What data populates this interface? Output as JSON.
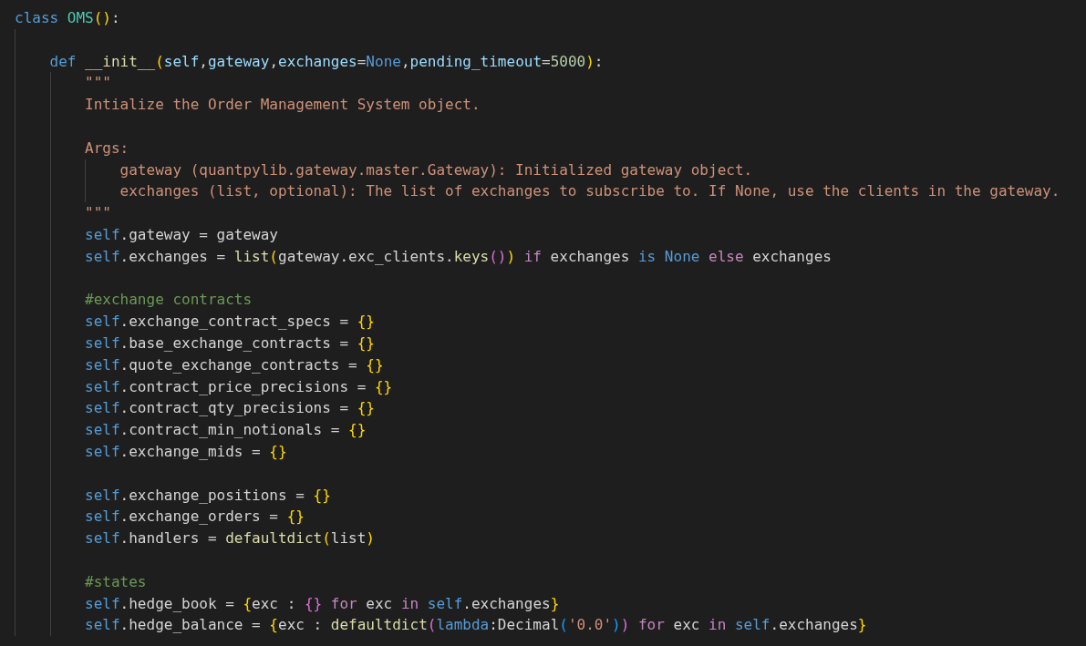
{
  "editor": {
    "lines": [
      {
        "kind": "code",
        "tokens": [
          {
            "kind": "keyword",
            "text": "class "
          },
          {
            "kind": "class",
            "text": "OMS"
          },
          {
            "kind": "bracket1",
            "text": "()"
          },
          {
            "kind": "plain",
            "text": ":"
          }
        ],
        "children": [
          {
            "kind": "blank"
          },
          {
            "kind": "code",
            "tokens": [
              {
                "kind": "keyword",
                "text": "def "
              },
              {
                "kind": "function",
                "text": "__init__"
              },
              {
                "kind": "bracket1",
                "text": "("
              },
              {
                "kind": "param",
                "text": "self"
              },
              {
                "kind": "plain",
                "text": ","
              },
              {
                "kind": "param",
                "text": "gateway"
              },
              {
                "kind": "plain",
                "text": ","
              },
              {
                "kind": "param",
                "text": "exchanges"
              },
              {
                "kind": "plain",
                "text": "="
              },
              {
                "kind": "keyword",
                "text": "None"
              },
              {
                "kind": "plain",
                "text": ","
              },
              {
                "kind": "param",
                "text": "pending_timeout"
              },
              {
                "kind": "plain",
                "text": "="
              },
              {
                "kind": "number",
                "text": "5000"
              },
              {
                "kind": "bracket1",
                "text": ")"
              },
              {
                "kind": "plain",
                "text": ":"
              }
            ],
            "children": [
              {
                "kind": "code",
                "tokens": [
                  {
                    "kind": "string",
                    "text": "\"\"\""
                  }
                ]
              },
              {
                "kind": "code",
                "tokens": [
                  {
                    "kind": "string",
                    "text": "Intialize the Order Management System object."
                  }
                ]
              },
              {
                "kind": "blank"
              },
              {
                "kind": "code",
                "tokens": [
                  {
                    "kind": "string",
                    "text": "Args:"
                  }
                ],
                "children": [
                  {
                    "kind": "code",
                    "tokens": [
                      {
                        "kind": "string",
                        "text": "gateway (quantpylib.gateway.master.Gateway): Initialized gateway object."
                      }
                    ]
                  },
                  {
                    "kind": "code",
                    "tokens": [
                      {
                        "kind": "string",
                        "text": "exchanges (list, optional): The list of exchanges to subscribe to. If None, use the clients in the gateway."
                      }
                    ]
                  }
                ]
              },
              {
                "kind": "code",
                "tokens": [
                  {
                    "kind": "string",
                    "text": "\"\"\""
                  }
                ]
              },
              {
                "kind": "code",
                "tokens": [
                  {
                    "kind": "self",
                    "text": "self"
                  },
                  {
                    "kind": "plain",
                    "text": ".gateway = gateway"
                  }
                ]
              },
              {
                "kind": "code",
                "tokens": [
                  {
                    "kind": "self",
                    "text": "self"
                  },
                  {
                    "kind": "plain",
                    "text": ".exchanges = "
                  },
                  {
                    "kind": "function",
                    "text": "list"
                  },
                  {
                    "kind": "bracket1",
                    "text": "("
                  },
                  {
                    "kind": "plain",
                    "text": "gateway.exc_clients."
                  },
                  {
                    "kind": "function",
                    "text": "keys"
                  },
                  {
                    "kind": "bracket2",
                    "text": "()"
                  },
                  {
                    "kind": "bracket1",
                    "text": ") "
                  },
                  {
                    "kind": "control",
                    "text": "if"
                  },
                  {
                    "kind": "plain",
                    "text": " exchanges "
                  },
                  {
                    "kind": "keyword",
                    "text": "is "
                  },
                  {
                    "kind": "keyword",
                    "text": "None "
                  },
                  {
                    "kind": "control",
                    "text": "else"
                  },
                  {
                    "kind": "plain",
                    "text": " exchanges"
                  }
                ]
              },
              {
                "kind": "blank"
              },
              {
                "kind": "code",
                "tokens": [
                  {
                    "kind": "comment",
                    "text": "#exchange contracts"
                  }
                ]
              },
              {
                "kind": "code",
                "tokens": [
                  {
                    "kind": "self",
                    "text": "self"
                  },
                  {
                    "kind": "plain",
                    "text": ".exchange_contract_specs = "
                  },
                  {
                    "kind": "bracket1",
                    "text": "{}"
                  }
                ]
              },
              {
                "kind": "code",
                "tokens": [
                  {
                    "kind": "self",
                    "text": "self"
                  },
                  {
                    "kind": "plain",
                    "text": ".base_exchange_contracts = "
                  },
                  {
                    "kind": "bracket1",
                    "text": "{}"
                  }
                ]
              },
              {
                "kind": "code",
                "tokens": [
                  {
                    "kind": "self",
                    "text": "self"
                  },
                  {
                    "kind": "plain",
                    "text": ".quote_exchange_contracts = "
                  },
                  {
                    "kind": "bracket1",
                    "text": "{}"
                  }
                ]
              },
              {
                "kind": "code",
                "tokens": [
                  {
                    "kind": "self",
                    "text": "self"
                  },
                  {
                    "kind": "plain",
                    "text": ".contract_price_precisions = "
                  },
                  {
                    "kind": "bracket1",
                    "text": "{}"
                  }
                ]
              },
              {
                "kind": "code",
                "tokens": [
                  {
                    "kind": "self",
                    "text": "self"
                  },
                  {
                    "kind": "plain",
                    "text": ".contract_qty_precisions = "
                  },
                  {
                    "kind": "bracket1",
                    "text": "{}"
                  }
                ]
              },
              {
                "kind": "code",
                "tokens": [
                  {
                    "kind": "self",
                    "text": "self"
                  },
                  {
                    "kind": "plain",
                    "text": ".contract_min_notionals = "
                  },
                  {
                    "kind": "bracket1",
                    "text": "{}"
                  }
                ]
              },
              {
                "kind": "code",
                "tokens": [
                  {
                    "kind": "self",
                    "text": "self"
                  },
                  {
                    "kind": "plain",
                    "text": ".exchange_mids = "
                  },
                  {
                    "kind": "bracket1",
                    "text": "{}"
                  }
                ]
              },
              {
                "kind": "blank"
              },
              {
                "kind": "code",
                "tokens": [
                  {
                    "kind": "self",
                    "text": "self"
                  },
                  {
                    "kind": "plain",
                    "text": ".exchange_positions = "
                  },
                  {
                    "kind": "bracket1",
                    "text": "{}"
                  }
                ]
              },
              {
                "kind": "code",
                "tokens": [
                  {
                    "kind": "self",
                    "text": "self"
                  },
                  {
                    "kind": "plain",
                    "text": ".exchange_orders = "
                  },
                  {
                    "kind": "bracket1",
                    "text": "{}"
                  }
                ]
              },
              {
                "kind": "code",
                "tokens": [
                  {
                    "kind": "self",
                    "text": "self"
                  },
                  {
                    "kind": "plain",
                    "text": ".handlers = "
                  },
                  {
                    "kind": "function",
                    "text": "defaultdict"
                  },
                  {
                    "kind": "bracket1",
                    "text": "("
                  },
                  {
                    "kind": "plain",
                    "text": "list"
                  },
                  {
                    "kind": "bracket1",
                    "text": ")"
                  }
                ]
              },
              {
                "kind": "blank"
              },
              {
                "kind": "code",
                "tokens": [
                  {
                    "kind": "comment",
                    "text": "#states"
                  }
                ]
              },
              {
                "kind": "code",
                "tokens": [
                  {
                    "kind": "self",
                    "text": "self"
                  },
                  {
                    "kind": "plain",
                    "text": ".hedge_book = "
                  },
                  {
                    "kind": "bracket1",
                    "text": "{"
                  },
                  {
                    "kind": "plain",
                    "text": "exc : "
                  },
                  {
                    "kind": "bracket2",
                    "text": "{} "
                  },
                  {
                    "kind": "control",
                    "text": "for"
                  },
                  {
                    "kind": "plain",
                    "text": " exc "
                  },
                  {
                    "kind": "control",
                    "text": "in "
                  },
                  {
                    "kind": "self",
                    "text": "self"
                  },
                  {
                    "kind": "plain",
                    "text": ".exchanges"
                  },
                  {
                    "kind": "bracket1",
                    "text": "}"
                  }
                ]
              },
              {
                "kind": "code",
                "tokens": [
                  {
                    "kind": "self",
                    "text": "self"
                  },
                  {
                    "kind": "plain",
                    "text": ".hedge_balance = "
                  },
                  {
                    "kind": "bracket1",
                    "text": "{"
                  },
                  {
                    "kind": "plain",
                    "text": "exc : "
                  },
                  {
                    "kind": "function",
                    "text": "defaultdict"
                  },
                  {
                    "kind": "bracket2",
                    "text": "("
                  },
                  {
                    "kind": "keyword",
                    "text": "lambda"
                  },
                  {
                    "kind": "plain",
                    "text": ":Decimal"
                  },
                  {
                    "kind": "bracket3",
                    "text": "("
                  },
                  {
                    "kind": "string",
                    "text": "'0.0'"
                  },
                  {
                    "kind": "bracket3",
                    "text": ")"
                  },
                  {
                    "kind": "bracket2",
                    "text": ") "
                  },
                  {
                    "kind": "control",
                    "text": "for"
                  },
                  {
                    "kind": "plain",
                    "text": " exc "
                  },
                  {
                    "kind": "control",
                    "text": "in "
                  },
                  {
                    "kind": "self",
                    "text": "self"
                  },
                  {
                    "kind": "plain",
                    "text": ".exchanges"
                  },
                  {
                    "kind": "bracket1",
                    "text": "}"
                  }
                ]
              }
            ]
          }
        ]
      }
    ]
  }
}
